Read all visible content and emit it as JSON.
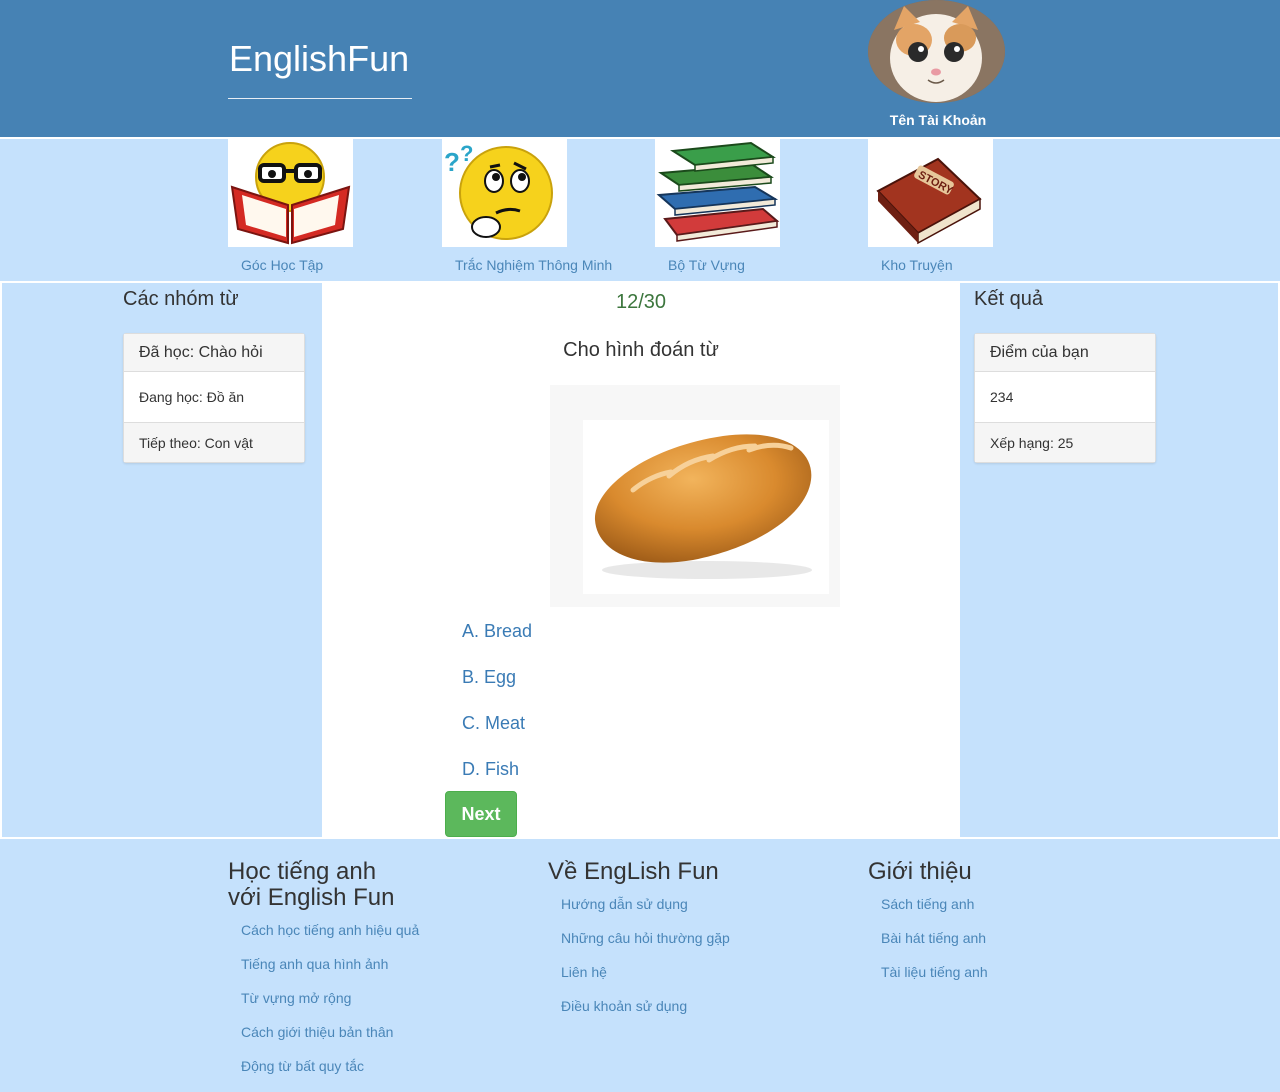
{
  "header": {
    "brand": "EnglishFun",
    "account_name": "Tên Tài Khoản"
  },
  "nav": {
    "items": [
      {
        "label": "Góc Học Tập",
        "icon": "reading-emoji-icon"
      },
      {
        "label": "Trắc Nghiệm Thông Minh",
        "icon": "thinking-emoji-icon"
      },
      {
        "label": "Bộ Từ Vựng",
        "icon": "books-stack-icon"
      },
      {
        "label": "Kho Truyện",
        "icon": "story-book-icon"
      }
    ]
  },
  "left_sidebar": {
    "title": "Các nhóm từ",
    "rows": [
      "Đã học: Chào hỏi",
      "Đang học: Đồ ăn",
      "Tiếp theo: Con vật"
    ]
  },
  "quiz": {
    "counter": "12/30",
    "question": "Cho hình đoán từ",
    "image": "bread-image",
    "options": [
      "A. Bread",
      "B. Egg",
      "C. Meat",
      "D. Fish"
    ],
    "next_label": "Next"
  },
  "right_sidebar": {
    "title": "Kết quả",
    "rows": [
      "Điểm của bạn",
      "234",
      "Xếp hạng: 25"
    ]
  },
  "footer": {
    "columns": [
      {
        "title_lines": [
          "Học tiếng anh",
          "với English Fun"
        ],
        "links": [
          "Cách học tiếng anh hiệu quả",
          "Tiếng anh qua hình ảnh",
          "Từ vựng mở rộng",
          "Cách giới thiệu bản thân",
          "Động từ bất quy tắc"
        ]
      },
      {
        "title_lines": [
          "Về EngLish Fun"
        ],
        "links": [
          "Hướng dẫn sử dụng",
          "Những câu hỏi thường gặp",
          "Liên hệ",
          "Điều khoản sử dụng"
        ]
      },
      {
        "title_lines": [
          "Giới thiệu"
        ],
        "links": [
          "Sách tiếng anh",
          "Bài hát tiếng anh",
          "Tài liệu tiếng anh"
        ]
      }
    ]
  },
  "colors": {
    "header_bg": "#4682b4",
    "band_bg": "#c5e1fc",
    "link": "#4a86b8",
    "next_button": "#5cb85c",
    "counter": "#3c763d"
  }
}
